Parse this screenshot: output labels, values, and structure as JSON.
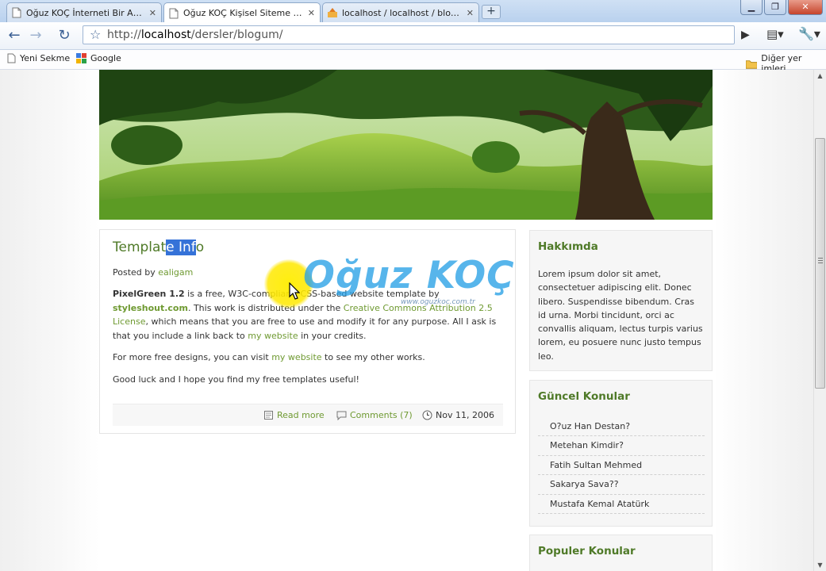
{
  "browser": {
    "tabs": [
      {
        "title": "Oğuz KOÇ İnterneti Bir Am...",
        "active": false
      },
      {
        "title": "Oğuz KOÇ Kişisel Siteme Ho...",
        "active": true
      },
      {
        "title": "localhost / localhost / blog_...",
        "active": false
      }
    ],
    "new_tab_label": "+",
    "url_scheme": "http://",
    "url_host": "localhost",
    "url_path": "/dersler/blogum/",
    "bookmarks": [
      {
        "label": "Yeni Sekme"
      },
      {
        "label": "Google"
      }
    ],
    "other_bookmarks": "Diğer yer imleri"
  },
  "post": {
    "title_before": "Templat",
    "title_selected": "e Inf",
    "title_after": "o",
    "posted_by_label": "Posted by",
    "author": "ealigam",
    "p1": {
      "brand": "PixelGreen 1.2",
      "t1": " is a free, W3C-compliant, CSS-based website template by ",
      "link1": "styleshout.com",
      "t2": ". This work is distributed under the ",
      "link2": "Creative Commons Attribution 2.5 License",
      "t3": ", which means that you are free to use and modify it for any purpose. All I ask is that you include a link back to ",
      "link3": "my website",
      "t4": " in your credits."
    },
    "p2": {
      "t1": "For more free designs, you can visit ",
      "link": "my website",
      "t2": " to see my other works."
    },
    "p3": "Good luck and I hope you find my free templates useful!",
    "footer": {
      "read_more": "Read more",
      "comments": "Comments (7)",
      "date": "Nov 11, 2006"
    }
  },
  "sidebar": {
    "about": {
      "title": "Hakkımda",
      "text": "Lorem ipsum dolor sit amet, consectetuer adipiscing elit. Donec libero. Suspendisse bibendum. Cras id urna. Morbi tincidunt, orci ac convallis aliquam, lectus turpis varius lorem, eu posuere nunc justo tempus leo."
    },
    "recent": {
      "title": "Güncel Konular",
      "items": [
        "O?uz Han Destan?",
        "Metehan Kimdir?",
        "Fatih Sultan Mehmed",
        "Sakarya Sava??",
        "Mustafa Kemal Atatürk"
      ]
    },
    "popular": {
      "title": "Populer Konular"
    }
  },
  "watermark": {
    "name": "Oğuz KOÇ",
    "url": "www.oguzkoc.com.tr"
  },
  "colors": {
    "accent_green": "#4f7a28",
    "link_green": "#6f9a32",
    "selection": "#3572d8",
    "watermark_blue": "#28a0e6"
  }
}
